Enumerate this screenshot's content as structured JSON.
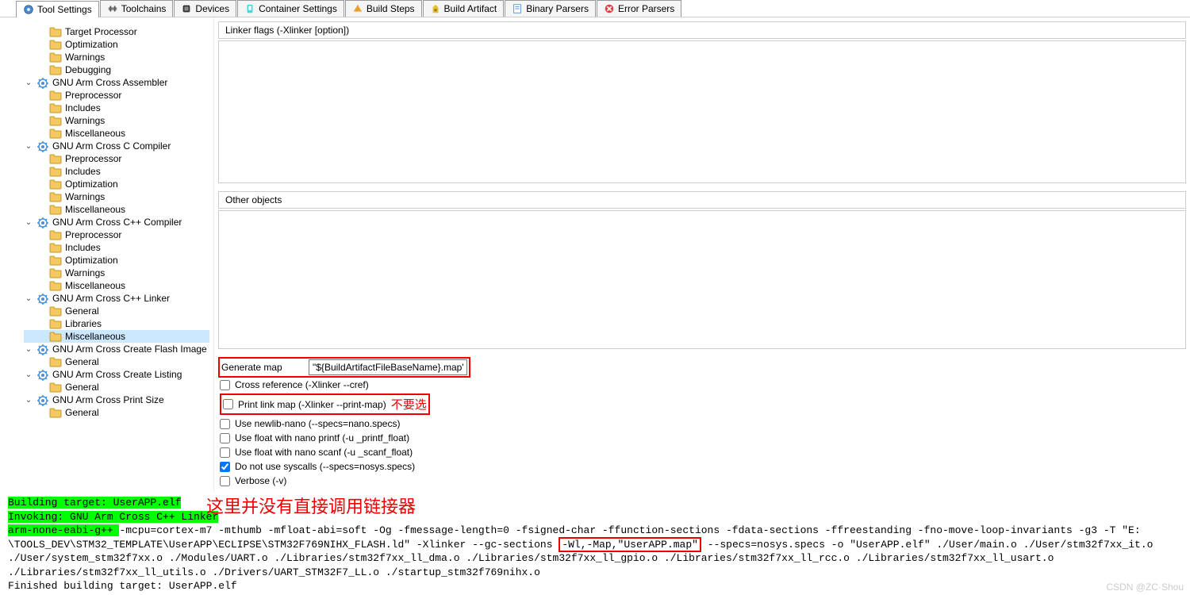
{
  "tabs": [
    {
      "label": "Tool Settings",
      "active": true
    },
    {
      "label": "Toolchains"
    },
    {
      "label": "Devices"
    },
    {
      "label": "Container Settings"
    },
    {
      "label": "Build Steps"
    },
    {
      "label": "Build Artifact"
    },
    {
      "label": "Binary Parsers"
    },
    {
      "label": "Error Parsers"
    }
  ],
  "tree": {
    "items": [
      {
        "label": "Target Processor",
        "depth": 1
      },
      {
        "label": "Optimization",
        "depth": 1
      },
      {
        "label": "Warnings",
        "depth": 1
      },
      {
        "label": "Debugging",
        "depth": 1
      },
      {
        "label": "GNU Arm Cross Assembler",
        "depth": 0,
        "expandable": true
      },
      {
        "label": "Preprocessor",
        "depth": 1
      },
      {
        "label": "Includes",
        "depth": 1
      },
      {
        "label": "Warnings",
        "depth": 1
      },
      {
        "label": "Miscellaneous",
        "depth": 1
      },
      {
        "label": "GNU Arm Cross C Compiler",
        "depth": 0,
        "expandable": true
      },
      {
        "label": "Preprocessor",
        "depth": 1
      },
      {
        "label": "Includes",
        "depth": 1
      },
      {
        "label": "Optimization",
        "depth": 1
      },
      {
        "label": "Warnings",
        "depth": 1
      },
      {
        "label": "Miscellaneous",
        "depth": 1
      },
      {
        "label": "GNU Arm Cross C++ Compiler",
        "depth": 0,
        "expandable": true
      },
      {
        "label": "Preprocessor",
        "depth": 1
      },
      {
        "label": "Includes",
        "depth": 1
      },
      {
        "label": "Optimization",
        "depth": 1
      },
      {
        "label": "Warnings",
        "depth": 1
      },
      {
        "label": "Miscellaneous",
        "depth": 1
      },
      {
        "label": "GNU Arm Cross C++ Linker",
        "depth": 0,
        "expandable": true
      },
      {
        "label": "General",
        "depth": 1
      },
      {
        "label": "Libraries",
        "depth": 1
      },
      {
        "label": "Miscellaneous",
        "depth": 1,
        "selected": true
      },
      {
        "label": "GNU Arm Cross Create Flash Image",
        "depth": 0,
        "expandable": true
      },
      {
        "label": "General",
        "depth": 1
      },
      {
        "label": "GNU Arm Cross Create Listing",
        "depth": 0,
        "expandable": true
      },
      {
        "label": "General",
        "depth": 1
      },
      {
        "label": "GNU Arm Cross Print Size",
        "depth": 0,
        "expandable": true
      },
      {
        "label": "General",
        "depth": 1
      }
    ]
  },
  "content": {
    "section1": "Linker flags (-Xlinker [option])",
    "section2": "Other objects",
    "generate_map_label": "Generate map",
    "generate_map_value": "\"${BuildArtifactFileBaseName}.map\"",
    "checkboxes": [
      {
        "label": "Cross reference (-Xlinker --cref)",
        "checked": false
      },
      {
        "label": "Print link map (-Xlinker --print-map)",
        "checked": false,
        "annot": "不要选",
        "redbox": true
      },
      {
        "label": "Use newlib-nano (--specs=nano.specs)",
        "checked": false
      },
      {
        "label": "Use float with nano printf (-u _printf_float)",
        "checked": false
      },
      {
        "label": "Use float with nano scanf (-u _scanf_float)",
        "checked": false
      },
      {
        "label": "Do not use syscalls (--specs=nosys.specs)",
        "checked": true
      },
      {
        "label": "Verbose (-v)",
        "checked": false
      }
    ]
  },
  "console": {
    "line1": "Building target: UserAPP.elf",
    "line2": "Invoking: GNU Arm Cross C++ Linker",
    "line3a": "arm-none-eabi-g++ ",
    "line3b": "-mcpu=cortex-m7 -mthumb -mfloat-abi=soft -Og -fmessage-length=0 -fsigned-char -ffunction-sections -fdata-sections -ffreestanding -fno-move-loop-invariants -g3 -T \"E:",
    "line4a": "\\TOOLS_DEV\\STM32_TEMPLATE\\UserAPP\\ECLIPSE\\STM32F769NIHX_FLASH.ld\" -Xlinker --gc-sections ",
    "line4b": "-Wl,-Map,\"UserAPP.map\"",
    "line4c": " --specs=nosys.specs -o \"UserAPP.elf\" ./User/main.o ./User/stm32f7xx_it.o",
    "line5": "./User/system_stm32f7xx.o  ./Modules/UART.o  ./Libraries/stm32f7xx_ll_dma.o ./Libraries/stm32f7xx_ll_gpio.o ./Libraries/stm32f7xx_ll_rcc.o ./Libraries/stm32f7xx_ll_usart.o",
    "line6": "./Libraries/stm32f7xx_ll_utils.o  ./Drivers/UART_STM32F7_LL.o  ./startup_stm32f769nihx.o",
    "line7": "Finished building target: UserAPP.elf",
    "overlay": "这里并没有直接调用链接器"
  },
  "watermark": "CSDN @ZC·Shou"
}
